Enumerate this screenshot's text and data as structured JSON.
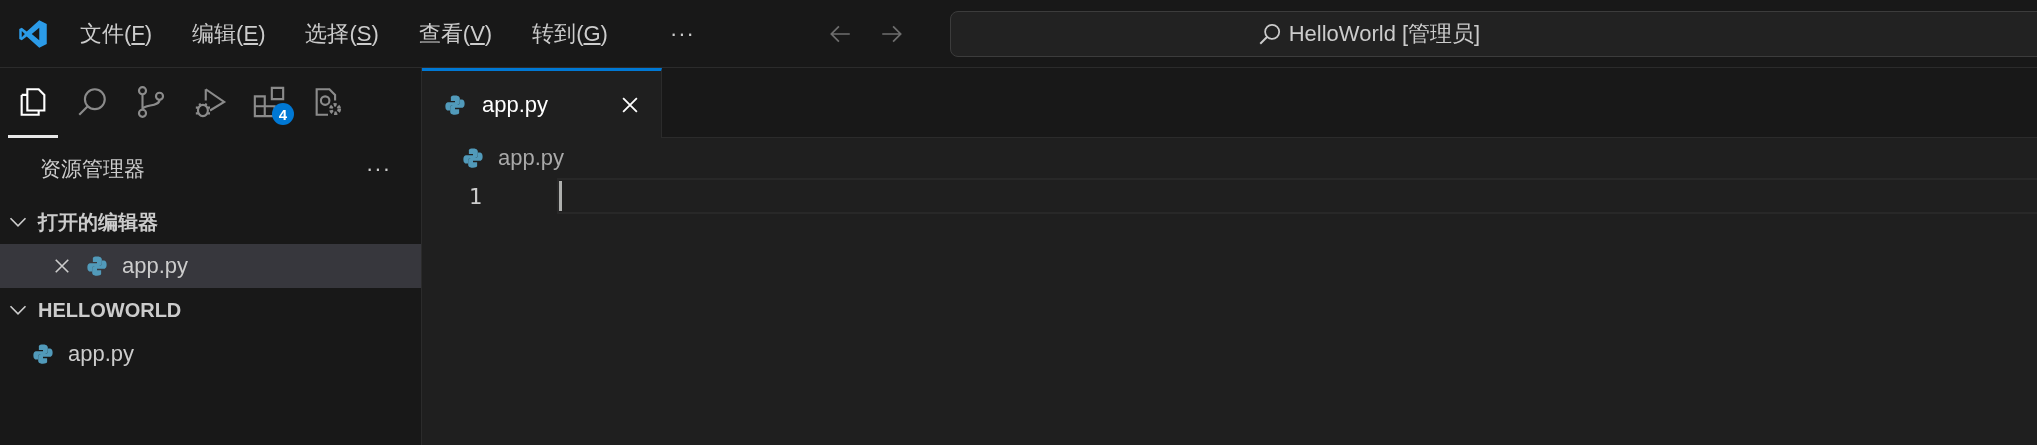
{
  "title_bar": {
    "menus": [
      {
        "before": "文件(",
        "key": "F",
        "after": ")"
      },
      {
        "before": "编辑(",
        "key": "E",
        "after": ")"
      },
      {
        "before": "选择(",
        "key": "S",
        "after": ")"
      },
      {
        "before": "查看(",
        "key": "V",
        "after": ")"
      },
      {
        "before": "转到(",
        "key": "G",
        "after": ")"
      }
    ],
    "more": "···",
    "search": {
      "value": "HelloWorld [管理员]"
    }
  },
  "activity_bar": {
    "items": [
      {
        "kind": "explorer",
        "selected": true
      },
      {
        "kind": "search",
        "selected": false
      },
      {
        "kind": "source-control",
        "selected": false
      },
      {
        "kind": "run-debug",
        "selected": false
      },
      {
        "kind": "extensions",
        "selected": false,
        "badge": "4"
      },
      {
        "kind": "settings-file",
        "selected": false
      }
    ]
  },
  "sidebar": {
    "title": "资源管理器",
    "more": "···",
    "sections": [
      {
        "title": "打开的编辑器",
        "expanded": true,
        "items": [
          {
            "name": "app.py",
            "selected": true,
            "closable": true
          }
        ]
      },
      {
        "title": "HELLOWORLD",
        "expanded": true,
        "items": [
          {
            "name": "app.py",
            "selected": false,
            "closable": false
          }
        ]
      }
    ]
  },
  "editor": {
    "tabs": [
      {
        "label": "app.py",
        "selected": true
      }
    ],
    "breadcrumb": [
      "app.py"
    ],
    "lines": [
      {
        "number": "1",
        "current": true
      }
    ]
  }
}
